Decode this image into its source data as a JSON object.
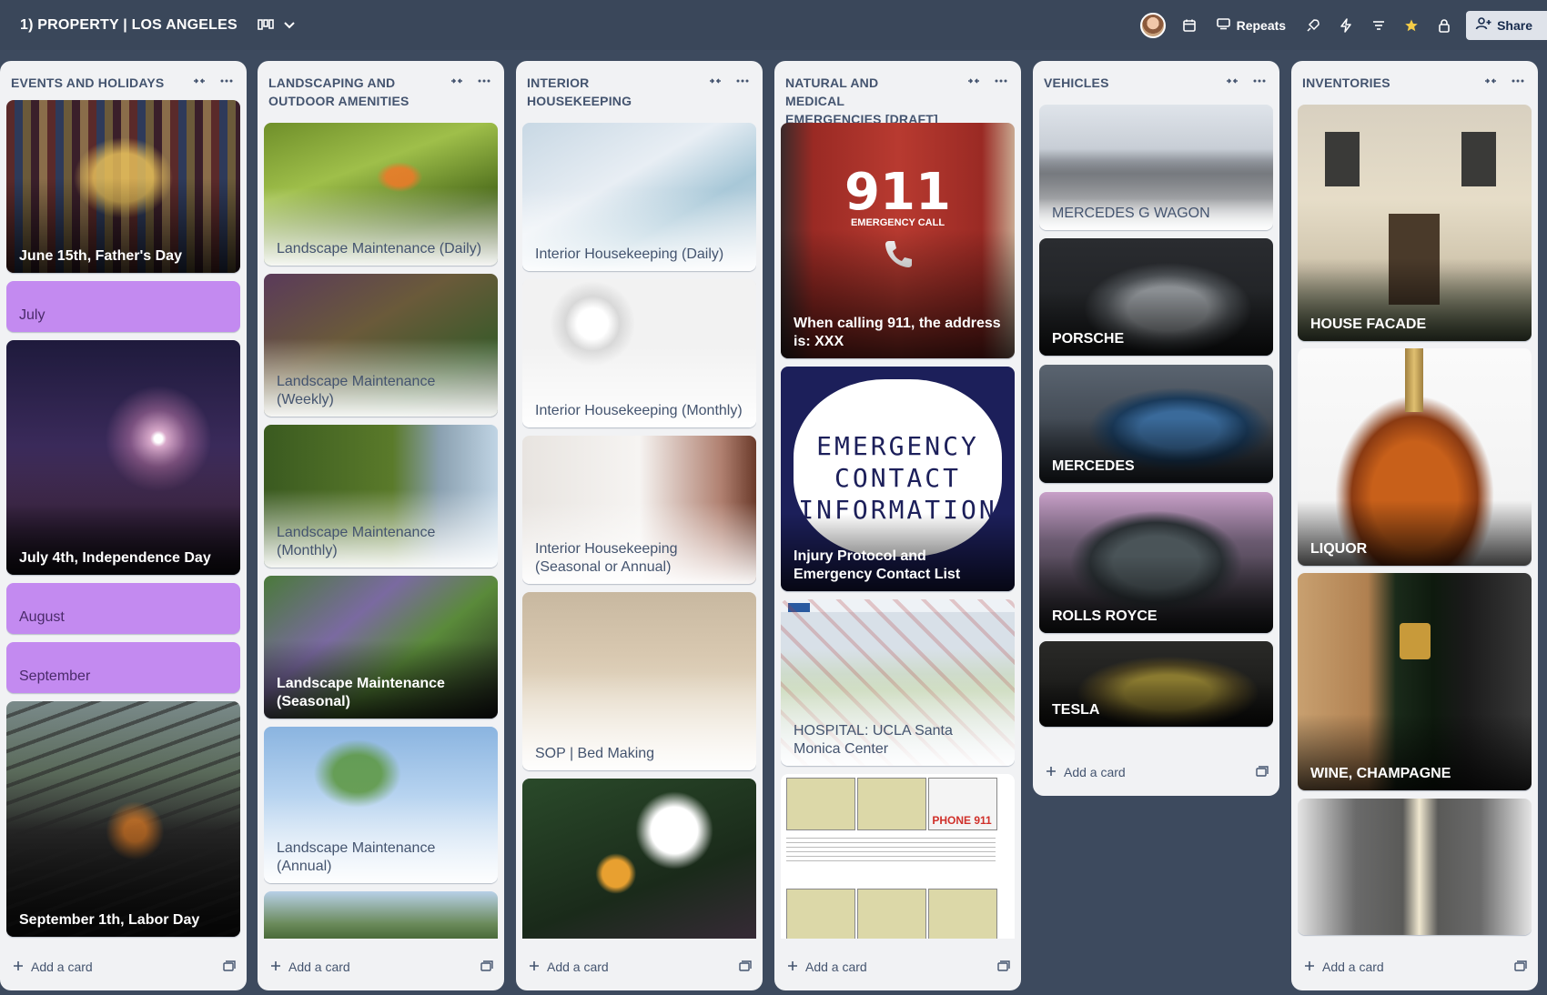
{
  "header": {
    "board_title": "1) PROPERTY | LOS ANGELES",
    "view_icon": "board-view-icon",
    "repeats_label": "Repeats",
    "share_label": "Share",
    "icons": [
      "avatar",
      "calendar-icon",
      "repeats-icon",
      "rocket-icon",
      "lightning-icon",
      "filter-icon",
      "star-icon",
      "lock-icon",
      "add-person-icon"
    ],
    "star_color": "#f5cd47"
  },
  "lists": [
    {
      "title": "EVENTS AND HOLIDAYS",
      "add_card_label": "Add a card",
      "cards": [
        {
          "title": "June 15th, Father's Day",
          "style": "dark"
        },
        {
          "title": "July",
          "style": "label"
        },
        {
          "title": "July 4th, Independence Day",
          "style": "dark"
        },
        {
          "title": "August",
          "style": "label"
        },
        {
          "title": "September",
          "style": "label"
        },
        {
          "title": "September 1th, Labor Day",
          "style": "dark"
        },
        {
          "title": "",
          "style": "label"
        }
      ]
    },
    {
      "title": "LANDSCAPING AND OUTDOOR AMENITIES",
      "add_card_label": "Add a card",
      "cards": [
        {
          "title": "Landscape Maintenance (Daily)",
          "style": "light"
        },
        {
          "title": "Landscape Maintenance (Weekly)",
          "style": "light"
        },
        {
          "title": "Landscape Maintenance (Monthly)",
          "style": "light"
        },
        {
          "title": "Landscape Maintenance (Seasonal)",
          "style": "dark"
        },
        {
          "title": "Landscape Maintenance (Annual)",
          "style": "light"
        },
        {
          "title": "",
          "style": "light"
        }
      ]
    },
    {
      "title": "INTERIOR HOUSEKEEPING",
      "add_card_label": "Add a card",
      "cards": [
        {
          "title": "Interior Housekeeping (Daily)",
          "style": "light"
        },
        {
          "title": "Interior Housekeeping (Monthly)",
          "style": "light"
        },
        {
          "title": "Interior Housekeeping (Seasonal or Annual)",
          "style": "light"
        },
        {
          "title": "SOP | Bed Making",
          "style": "light"
        },
        {
          "title": "",
          "style": "dark"
        }
      ]
    },
    {
      "title": "NATURAL AND MEDICAL EMERGENCIES [DRAFT]",
      "add_card_label": "Add a card",
      "cards": [
        {
          "title": "When calling 911, the address is: XXX",
          "style": "dark"
        },
        {
          "title": "Injury Protocol and Emergency Contact List",
          "style": "dark"
        },
        {
          "title": "HOSPITAL: UCLA Santa Monica Center",
          "style": "light"
        },
        {
          "title": "",
          "style": "light"
        }
      ],
      "graphics": {
        "phone_number": "911",
        "phone_subtext": "EMERGENCY CALL",
        "emergency_lines": [
          "EMERGENCY",
          "CONTACT",
          "INFORMATION"
        ],
        "cpr_text": "PHONE 911"
      }
    },
    {
      "title": "VEHICLES",
      "add_card_label": "Add a card",
      "cards": [
        {
          "title": "MERCEDES G WAGON",
          "style": "light"
        },
        {
          "title": "PORSCHE",
          "style": "dark"
        },
        {
          "title": "MERCEDES",
          "style": "dark"
        },
        {
          "title": "ROLLS ROYCE",
          "style": "dark"
        },
        {
          "title": "TESLA",
          "style": "dark"
        }
      ]
    },
    {
      "title": "INVENTORIES",
      "add_card_label": "Add a card",
      "cards": [
        {
          "title": "HOUSE FACADE",
          "style": "dark"
        },
        {
          "title": "LIQUOR",
          "style": "dark"
        },
        {
          "title": "WINE, CHAMPAGNE",
          "style": "dark"
        },
        {
          "title": "",
          "style": "light"
        }
      ]
    }
  ]
}
